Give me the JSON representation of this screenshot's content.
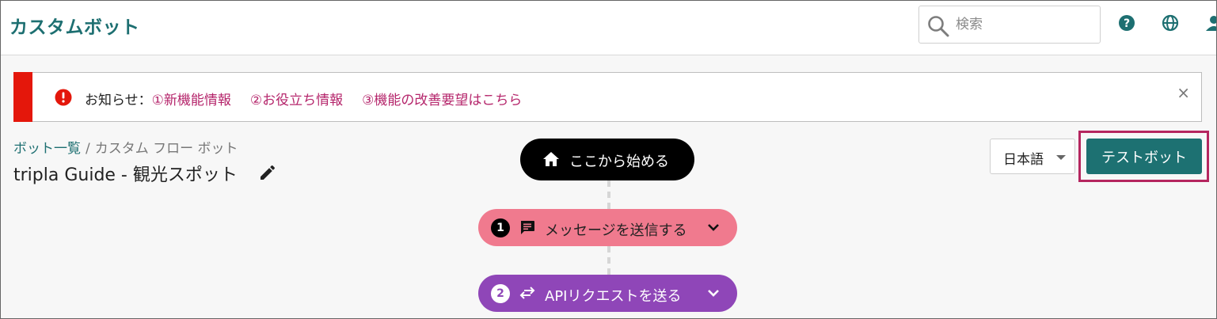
{
  "app": {
    "title": "カスタムボット"
  },
  "search": {
    "placeholder": "検索"
  },
  "notice": {
    "prefix": "お知らせ：",
    "links": [
      "①新機能情報",
      "②お役立ち情報",
      "③機能の改善要望はこちら"
    ],
    "close": "×"
  },
  "breadcrumb": {
    "items": [
      "ボット一覧",
      "カスタム フロー ボット"
    ],
    "separator": "/"
  },
  "page": {
    "title": "tripla Guide - 観光スポット"
  },
  "language": {
    "selected": "日本語"
  },
  "actions": {
    "test_bot": "テストボット"
  },
  "flow": {
    "start": "ここから始める",
    "steps": [
      {
        "number": "1",
        "label": "メッセージを送信する",
        "icon": "chat-icon",
        "color": "#f07a8e"
      },
      {
        "number": "2",
        "label": "APIリクエストを送る",
        "icon": "swap-arrows-icon",
        "color": "#8f46b8"
      }
    ]
  },
  "colors": {
    "brand": "#1d6f71",
    "alert": "#e4170b",
    "link": "#b5256b",
    "highlight": "#b5265f"
  },
  "icons": [
    "search-icon",
    "help-icon",
    "globe-icon",
    "user-icon",
    "alert-icon",
    "edit-icon",
    "home-icon",
    "chat-icon",
    "swap-arrows-icon",
    "chevron-down-icon"
  ]
}
